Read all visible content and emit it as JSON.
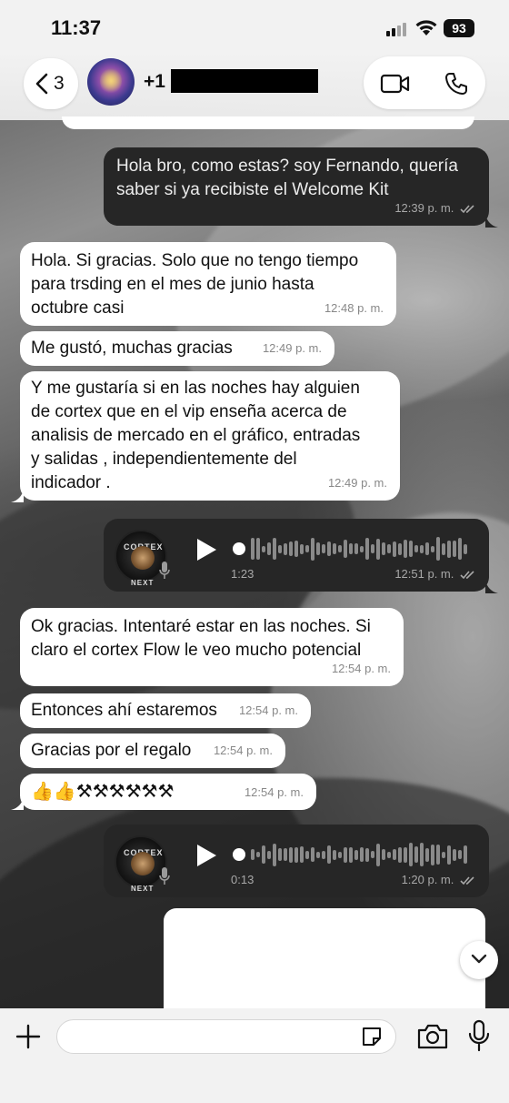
{
  "status_bar": {
    "time": "11:37",
    "battery": "93"
  },
  "header": {
    "back_count": "3",
    "contact_name": "+1"
  },
  "messages": [
    {
      "id": "m1",
      "dir": "out",
      "text": "Hola bro, como estas? soy Fernando, quería\nsaber si ya recibiste el Welcome Kit",
      "time": "12:39 p. m."
    },
    {
      "id": "m2",
      "dir": "in",
      "text": "Hola. Si gracias.  Solo que no tengo tiempo\npara trsding en el mes de junio hasta\noctubre casi",
      "time": "12:48 p. m."
    },
    {
      "id": "m3",
      "dir": "in",
      "text": "Me gustó,  muchas gracias",
      "time": "12:49 p. m."
    },
    {
      "id": "m4",
      "dir": "in",
      "text": "Y me gustaría si en las noches hay alguien\nde cortex que en el vip enseña acerca de\nanalisis de mercado en el gráfico,  entradas\ny salidas , independientemente del\nindicador .",
      "time": "12:49 p. m."
    },
    {
      "id": "v1",
      "dir": "out",
      "type": "voice",
      "duration": "1:23",
      "time": "12:51 p. m.",
      "avatar_top": "CORTEX",
      "avatar_bottom": "NEXT"
    },
    {
      "id": "m5",
      "dir": "in",
      "text": "Ok gracias.  Intentaré estar en las noches. Si\nclaro el cortex Flow le veo mucho potencial",
      "time": "12:54 p. m."
    },
    {
      "id": "m6",
      "dir": "in",
      "text": "Entonces ahí estaremos",
      "time": "12:54 p. m."
    },
    {
      "id": "m7",
      "dir": "in",
      "text": "Gracias por el regalo",
      "time": "12:54 p. m."
    },
    {
      "id": "m8",
      "dir": "in",
      "text": "👍👍⚒⚒⚒⚒⚒⚒",
      "time": "12:54 p. m."
    },
    {
      "id": "v2",
      "dir": "out",
      "type": "voice",
      "duration": "0:13",
      "time": "1:20 p. m.",
      "avatar_top": "CORTEX",
      "avatar_bottom": "NEXT"
    }
  ],
  "composer": {
    "value": ""
  },
  "colors": {
    "incoming": "#ffffff",
    "outgoing": "#262626",
    "chrome": "#f2f2f2"
  },
  "icons": [
    "back-chevron-icon",
    "video-call-icon",
    "phone-icon",
    "play-icon",
    "mic-icon",
    "double-check-icon",
    "chevron-down-icon",
    "plus-icon",
    "sticker-icon",
    "camera-icon"
  ]
}
